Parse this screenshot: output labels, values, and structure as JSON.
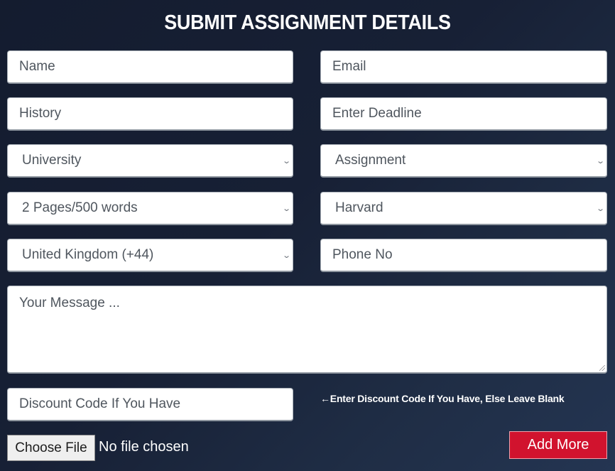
{
  "header": {
    "title": "SUBMIT ASSIGNMENT DETAILS"
  },
  "form": {
    "name": {
      "placeholder": "Name"
    },
    "email": {
      "placeholder": "Email"
    },
    "subject": {
      "value": "History"
    },
    "deadline": {
      "placeholder": "Enter Deadline"
    },
    "level_select": {
      "selected": "University"
    },
    "type_select": {
      "selected": "Assignment"
    },
    "pages_select": {
      "selected": "2 Pages/500 words"
    },
    "referencing_select": {
      "selected": "Harvard"
    },
    "country_select": {
      "selected": "United Kingdom (+44)"
    },
    "phone": {
      "placeholder": "Phone No"
    },
    "message": {
      "placeholder": "Your Message ..."
    },
    "discount": {
      "placeholder": "Discount Code If You Have"
    },
    "discount_hint": "←Enter Discount Code If You Have, Else Leave Blank",
    "file": {
      "button_label": "Choose File",
      "status": "No file chosen"
    },
    "add_more_label": "Add More"
  },
  "icons": {
    "select_arrow": "chevron-down-icon",
    "resize": "resize-handle-icon"
  },
  "colors": {
    "accent_button": "#d1132e",
    "background": "#172035",
    "field_text": "#4f565e"
  }
}
